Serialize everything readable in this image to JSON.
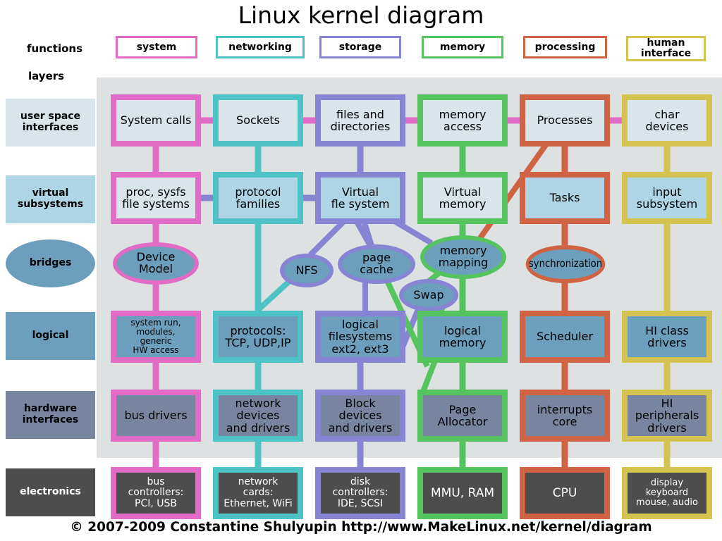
{
  "title": "Linux kernel diagram",
  "footer": "© 2007-2009 Constantine Shulyupin http://www.MakeLinux.net/kernel/diagram",
  "row_headers": {
    "functions": "functions",
    "layers": "layers"
  },
  "colors": {
    "system": "#e06cc6",
    "networking": "#4fc2c6",
    "storage": "#8784d4",
    "memory": "#56c45e",
    "processing": "#cf6344",
    "human_interface": "#d4c251",
    "panel": "#dde1e1",
    "user_space_fill": "#d9e5ea",
    "virtual_fill": "#aed4e6",
    "bridges_fill": "#6b9fbc",
    "logical_fill": "#6b9fbc",
    "hardware_fill": "#7785a0",
    "electronics_fill": "#4d4d4d",
    "electronics_text": "#ffffff",
    "background": "#ffffff"
  },
  "functions": [
    {
      "id": "system",
      "label": "system",
      "color": "#e06cc6"
    },
    {
      "id": "networking",
      "label": "networking",
      "color": "#4fc2c6"
    },
    {
      "id": "storage",
      "label": "storage",
      "color": "#8784d4"
    },
    {
      "id": "memory",
      "label": "memory",
      "color": "#56c45e"
    },
    {
      "id": "processing",
      "label": "processing",
      "color": "#cf6344"
    },
    {
      "id": "human_interface",
      "label": "human\ninterface",
      "color": "#d4c251"
    }
  ],
  "layers": [
    {
      "id": "user_space",
      "label": "user space\ninterfaces",
      "fill": "#d9e5ea",
      "shape": "rect",
      "text": "#000000"
    },
    {
      "id": "virtual",
      "label": "virtual\nsubsystems",
      "fill": "#aed4e6",
      "shape": "rect",
      "text": "#000000"
    },
    {
      "id": "bridges",
      "label": "bridges",
      "fill": "#6b9fbc",
      "shape": "oval",
      "text": "#000000"
    },
    {
      "id": "logical",
      "label": "logical",
      "fill": "#6b9fbc",
      "shape": "rect",
      "text": "#000000"
    },
    {
      "id": "hardware",
      "label": "hardware\ninterfaces",
      "fill": "#7785a0",
      "shape": "rect",
      "text": "#000000"
    },
    {
      "id": "electronics",
      "label": "electronics",
      "fill": "#4d4d4d",
      "shape": "rect",
      "text": "#ffffff"
    }
  ],
  "nodes": {
    "user_space": [
      {
        "label": "System calls",
        "column": "system"
      },
      {
        "label": "Sockets",
        "column": "networking"
      },
      {
        "label": "files and\ndirectories",
        "column": "storage"
      },
      {
        "label": "memory\naccess",
        "column": "memory"
      },
      {
        "label": "Processes",
        "column": "processing"
      },
      {
        "label": "char\ndevices",
        "column": "human_interface"
      }
    ],
    "virtual": [
      {
        "label": "proc, sysfs\nfile systems",
        "column": "system"
      },
      {
        "label": "protocol\nfamilies",
        "column": "networking"
      },
      {
        "label": "Virtual\nfle system",
        "column": "storage"
      },
      {
        "label": "Virtual\nmemory",
        "column": "memory"
      },
      {
        "label": "Tasks",
        "column": "processing"
      },
      {
        "label": "input\nsubsystem",
        "column": "human_interface"
      }
    ],
    "bridges": [
      {
        "label": "Device\nModel",
        "column": "system"
      },
      {
        "label": "NFS",
        "column": "storage"
      },
      {
        "label": "page\ncache",
        "column": "storage"
      },
      {
        "label": "Swap",
        "column": "storage"
      },
      {
        "label": "memory\nmapping",
        "column": "memory"
      },
      {
        "label": "synchronization",
        "column": "processing"
      }
    ],
    "logical": [
      {
        "label": "system run,\nmodules,\ngeneric\nHW access",
        "column": "system"
      },
      {
        "label": "protocols:\nTCP, UDP,IP",
        "column": "networking"
      },
      {
        "label": "logical\nfilesystems\next2, ext3",
        "column": "storage"
      },
      {
        "label": "logical\nmemory",
        "column": "memory"
      },
      {
        "label": "Scheduler",
        "column": "processing"
      },
      {
        "label": "HI class\ndrivers",
        "column": "human_interface"
      }
    ],
    "hardware": [
      {
        "label": "bus drivers",
        "column": "system"
      },
      {
        "label": "network\ndevices\nand drivers",
        "column": "networking"
      },
      {
        "label": "Block\ndevices\nand drivers",
        "column": "storage"
      },
      {
        "label": "Page\nAllocator",
        "column": "memory"
      },
      {
        "label": "interrupts\ncore",
        "column": "processing"
      },
      {
        "label": "HI\nperipherals\ndrivers",
        "column": "human_interface"
      }
    ],
    "electronics": [
      {
        "label": "bus\ncontrollers:\nPCI, USB",
        "column": "system"
      },
      {
        "label": "network\ncards:\nEthernet, WiFi",
        "column": "networking"
      },
      {
        "label": "disk\ncontrollers:\nIDE, SCSI",
        "column": "storage"
      },
      {
        "label": "MMU, RAM",
        "column": "memory"
      },
      {
        "label": "CPU",
        "column": "processing"
      },
      {
        "label": "display\nkeyboard\nmouse, audio",
        "column": "human_interface"
      }
    ]
  }
}
